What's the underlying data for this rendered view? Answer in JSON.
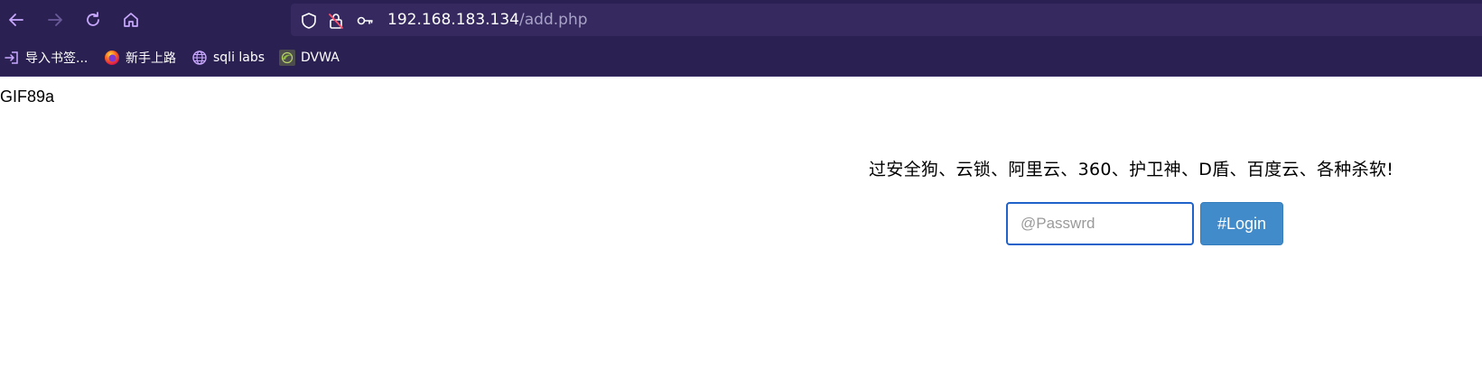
{
  "browser": {
    "url_host": "192.168.183.134",
    "url_path": "/add.php",
    "icons": [
      "back-icon",
      "forward-icon",
      "reload-icon",
      "home-icon",
      "shield-icon",
      "lock-off-icon",
      "key-icon"
    ]
  },
  "bookmarks": [
    {
      "label": "导入书签...",
      "icon": "import-icon"
    },
    {
      "label": "新手上路",
      "icon": "firefox-icon"
    },
    {
      "label": "sqli labs",
      "icon": "globe-icon"
    },
    {
      "label": "DVWA",
      "icon": "dvwa-icon"
    }
  ],
  "page": {
    "gif_header": "GIF89a",
    "slogan": "过安全狗、云锁、阿里云、360、护卫神、D盾、百度云、各种杀软!",
    "password_placeholder": "@Passwrd",
    "password_value": "",
    "login_label": "#Login"
  },
  "colors": {
    "chrome_bg": "#2b2052",
    "urlbar_bg": "#35295f",
    "accent_icon": "#c8a8ff",
    "button_bg": "#428bca",
    "input_border": "#1f62c9"
  }
}
